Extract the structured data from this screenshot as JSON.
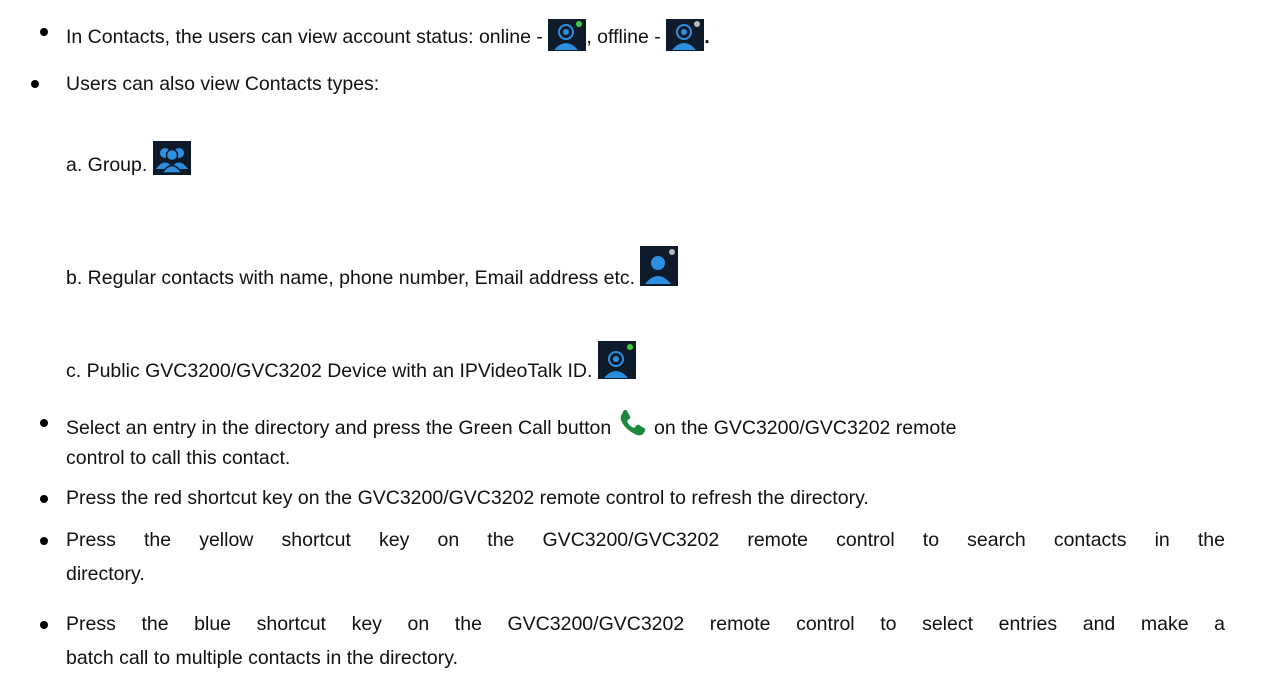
{
  "bullets": {
    "status": {
      "prefix": "In Contacts, the users can view account status: online - ",
      "middle": ", offline - ",
      "suffix": ".",
      "online_icon": "ipvideotalk-device-online-icon",
      "offline_icon": "ipvideotalk-device-offline-icon"
    },
    "types_intro": "Users can also view Contacts types:",
    "types": [
      {
        "label": "a. Group. ",
        "icon": "group-contacts-icon"
      },
      {
        "label": "b. Regular contacts with name, phone number, Email address etc. ",
        "icon": "regular-contact-icon"
      },
      {
        "label": "c. Public GVC3200/GVC3202 Device with an IPVideoTalk ID. ",
        "icon": "public-device-icon"
      }
    ],
    "call": {
      "prefix": "Select an entry in the directory and press the Green Call button ",
      "suffix": " on the GVC3200/GVC3202 remote",
      "continuation": "control to call this contact.",
      "icon": "green-call-icon"
    },
    "refresh": "Press the red shortcut key on the GVC3200/GVC3202 remote control to refresh the directory.",
    "search": {
      "line1": "Press the yellow shortcut key on the GVC3200/GVC3202 remote control to search contacts in the",
      "line2": "directory."
    },
    "batch": {
      "line1": "Press the blue shortcut key on the GVC3200/GVC3202 remote control to select entries and make a",
      "line2": "batch call to multiple contacts in the directory."
    }
  },
  "colors": {
    "icon_background": "#0d1b2a",
    "icon_blue": "#2d8fe0",
    "online_dot": "#3ecf3e",
    "offline_dot": "#b8b8b8",
    "call_green": "#1a8a3a"
  }
}
